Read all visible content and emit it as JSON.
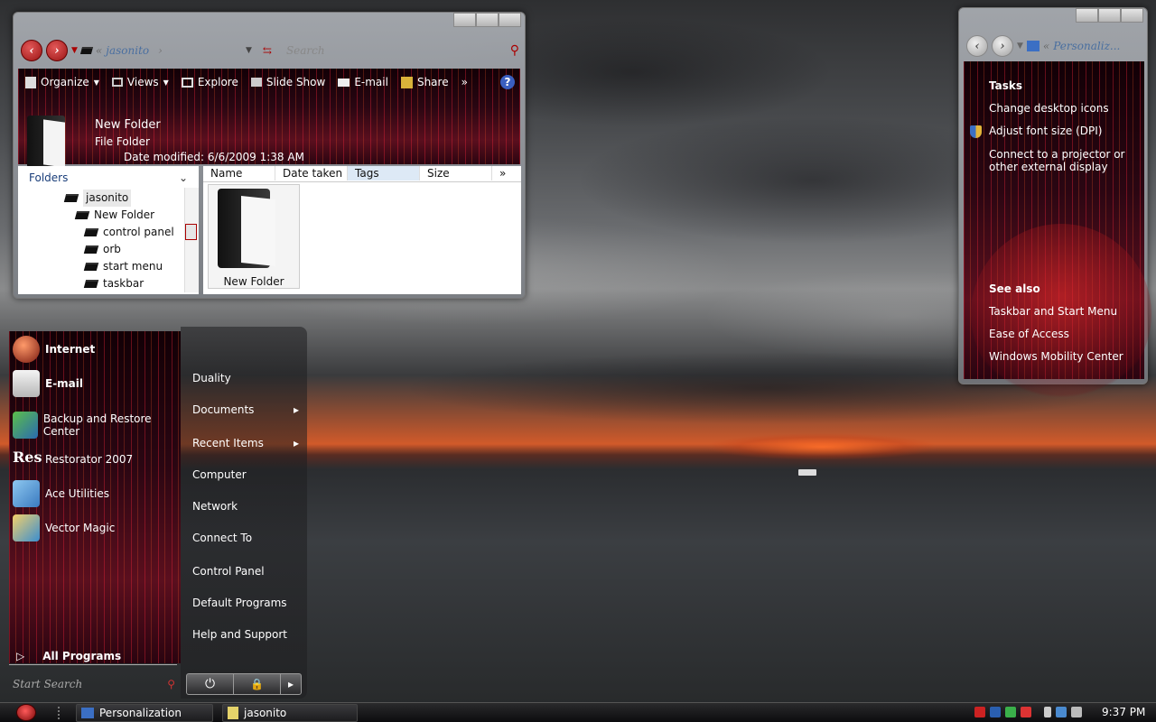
{
  "explorer": {
    "address": "jasonito",
    "search_placeholder": "Search",
    "toolbar": [
      "Organize",
      "Views",
      "Explore",
      "Slide Show",
      "E-mail",
      "Share"
    ],
    "more": "»",
    "details": {
      "name": "New Folder",
      "type": "File Folder",
      "modified": "Date modified: 6/6/2009 1:38 AM"
    },
    "folders_label": "Folders",
    "tree": [
      "jasonito",
      "New Folder",
      "control panel",
      "orb",
      "start menu",
      "taskbar"
    ],
    "columns": [
      "Name",
      "Date taken",
      "Tags",
      "Size"
    ],
    "item": "New Folder"
  },
  "personalization": {
    "address": "Personaliz...",
    "tasks_heading": "Tasks",
    "tasks": [
      "Change desktop icons",
      "Adjust font size (DPI)",
      "Connect to a projector or other external display"
    ],
    "see_also_heading": "See also",
    "see_also": [
      "Taskbar and Start Menu",
      "Ease of Access",
      "Windows Mobility Center"
    ]
  },
  "start_menu": {
    "pinned": [
      "Internet",
      "E-mail"
    ],
    "recent": [
      "Backup and Restore Center",
      "Restorator 2007",
      "Ace Utilities",
      "Vector Magic"
    ],
    "res_icon_text": "Res",
    "all_programs": "All Programs",
    "search_placeholder": "Start Search",
    "right": [
      "Duality",
      "Documents",
      "Recent Items",
      "Computer",
      "Network",
      "Connect To",
      "Control Panel",
      "Default Programs",
      "Help and Support"
    ],
    "submenu_arrow": "▸"
  },
  "taskbar": {
    "buttons": [
      "Personalization",
      "jasonito"
    ],
    "clock": "9:37 PM"
  },
  "colors": {
    "accent": "#8b1020",
    "stripe": "#ff2840"
  }
}
